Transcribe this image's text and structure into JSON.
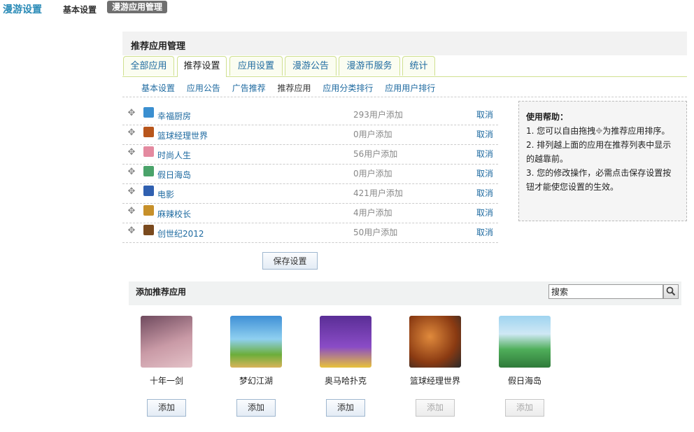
{
  "header": {
    "brand": "漫游设置",
    "nav_basic": "基本设置",
    "nav_active": "漫游应用管理"
  },
  "panel": {
    "title": "推荐应用管理",
    "tabs": [
      "全部应用",
      "推荐设置",
      "应用设置",
      "漫游公告",
      "漫游币服务",
      "统计"
    ],
    "active_tab": "推荐设置",
    "subnav": [
      "基本设置",
      "应用公告",
      "广告推荐",
      "推荐应用",
      "应用分类排行",
      "应用用户排行"
    ],
    "active_subnav": "推荐应用"
  },
  "recommended": [
    {
      "name": "幸福厨房",
      "count": "293用户添加",
      "action": "取消",
      "icon": "kitchen-icon",
      "color": "#3b8fd0"
    },
    {
      "name": "篮球经理世界",
      "count": "0用户添加",
      "action": "取消",
      "icon": "basketball-icon",
      "color": "#b8561c"
    },
    {
      "name": "时尚人生",
      "count": "56用户添加",
      "action": "取消",
      "icon": "fashion-icon",
      "color": "#e48aa0"
    },
    {
      "name": "假日海岛",
      "count": "0用户添加",
      "action": "取消",
      "icon": "island-icon",
      "color": "#4aa36a"
    },
    {
      "name": "电影",
      "count": "421用户添加",
      "action": "取消",
      "icon": "movie-icon",
      "color": "#3060b0"
    },
    {
      "name": "麻辣校长",
      "count": "4用户添加",
      "action": "取消",
      "icon": "school-icon",
      "color": "#c7902a"
    },
    {
      "name": "创世纪2012",
      "count": "50用户添加",
      "action": "取消",
      "icon": "genesis-icon",
      "color": "#7a4a1e"
    }
  ],
  "save_label": "保存设置",
  "help": {
    "title": "使用帮助：",
    "line1": "1. 您可以自由拖拽",
    "line1b": "为推荐应用排序。",
    "line2": "2. 排列越上面的应用在推荐列表中显示的越靠前。",
    "line3": "3. 您的修改操作，必需点击保存设置按钮才能使您设置的生效。"
  },
  "add_section": {
    "title": "添加推荐应用",
    "search_value": "搜索",
    "apps": [
      {
        "name": "十年一剑",
        "button": "添加",
        "enabled": true,
        "icon": "sword-game-icon",
        "color": "#b07a8a"
      },
      {
        "name": "梦幻江湖",
        "button": "添加",
        "enabled": true,
        "icon": "fantasy-game-icon",
        "color": "#4f9ad8"
      },
      {
        "name": "奥马哈扑克",
        "button": "添加",
        "enabled": true,
        "icon": "poker-icon",
        "color": "#7a3fb0"
      },
      {
        "name": "篮球经理世界",
        "button": "添加",
        "enabled": false,
        "icon": "basketball-icon",
        "color": "#a04a18"
      },
      {
        "name": "假日海岛",
        "button": "添加",
        "enabled": false,
        "icon": "island-icon",
        "color": "#3e9b5a"
      }
    ]
  }
}
